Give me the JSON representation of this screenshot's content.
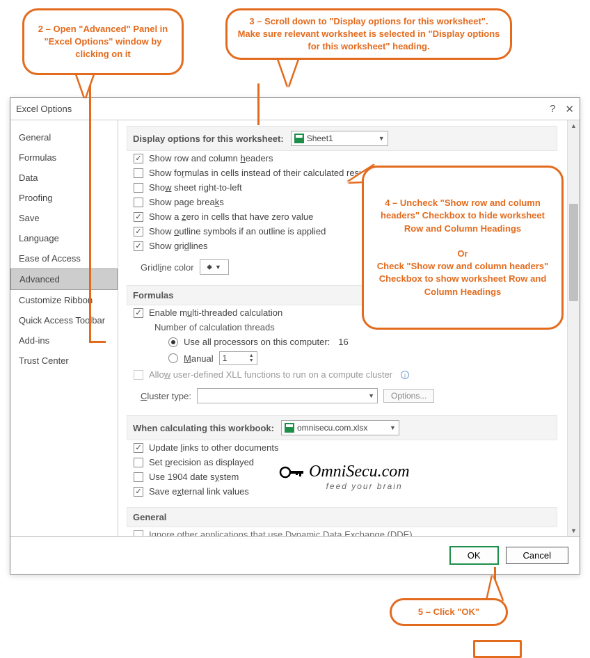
{
  "window": {
    "title": "Excel Options"
  },
  "sidebar": {
    "items": [
      {
        "label": "General"
      },
      {
        "label": "Formulas"
      },
      {
        "label": "Data"
      },
      {
        "label": "Proofing"
      },
      {
        "label": "Save"
      },
      {
        "label": "Language"
      },
      {
        "label": "Ease of Access"
      },
      {
        "label": "Advanced"
      },
      {
        "label": "Customize Ribbon"
      },
      {
        "label": "Quick Access Toolbar"
      },
      {
        "label": "Add-ins"
      },
      {
        "label": "Trust Center"
      }
    ],
    "active_index": 7
  },
  "sections": {
    "display_ws": {
      "heading": "Display options for this worksheet:",
      "sheet": "Sheet1",
      "opts": {
        "row_col_headers": "Show row and column headers",
        "show_formulas": "Show formulas in cells instead of their calculated results",
        "rtl": "Show sheet right-to-left",
        "page_breaks": "Show page breaks",
        "zero": "Show a zero in cells that have zero value",
        "outline": "Show outline symbols if an outline is applied",
        "gridlines": "Show gridlines",
        "gridline_color_label": "Gridline color"
      }
    },
    "formulas": {
      "heading": "Formulas",
      "multi": "Enable multi-threaded calculation",
      "threads_label": "Number of calculation threads",
      "use_all": "Use all processors on this computer:",
      "processor_count": "16",
      "manual": "Manual",
      "manual_value": "1",
      "xll": "Allow user-defined XLL functions to run on a compute cluster",
      "cluster_label": "Cluster type:",
      "options_btn": "Options..."
    },
    "calc_wb": {
      "heading": "When calculating this workbook:",
      "workbook": "omnisecu.com.xlsx",
      "update_links": "Update links to other documents",
      "precision": "Set precision as displayed",
      "date1904": "Use 1904 date system",
      "ext_links": "Save external link values"
    },
    "general": {
      "heading": "General",
      "dde": "Ignore other applications that use Dynamic Data Exchange (DDE)"
    }
  },
  "footer": {
    "ok": "OK",
    "cancel": "Cancel"
  },
  "callouts": {
    "c2": "2 – Open \"Advanced\" Panel in \"Excel Options\" window by clicking on it",
    "c3": "3 – Scroll down to \"Display options for this worksheet\". Make sure relevant worksheet is selected in \"Display options for this worksheet\" heading.",
    "c4": "4 – Uncheck \"Show row and column headers\" Checkbox to hide worksheet Row and Column Headings\n\nOr\nCheck \"Show row and column headers\" Checkbox to show worksheet Row and Column Headings",
    "c5": "5 – Click \"OK\""
  },
  "watermark": {
    "brand": "OmniSecu.com",
    "tag": "feed your brain"
  }
}
